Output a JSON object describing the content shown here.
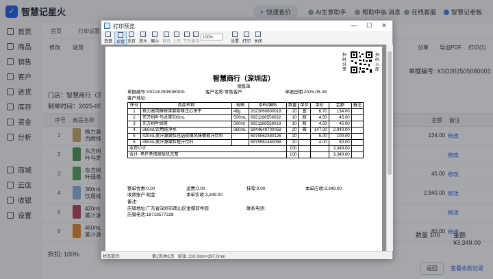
{
  "app": {
    "title": "智慧记星火",
    "quick_price": "快速查价",
    "ai_assistant": "AI生意助手",
    "help_center": "帮助中心",
    "messages": "消息",
    "online_customer": "在线客服",
    "account": "智慧记老板"
  },
  "sidebar": {
    "items": [
      {
        "label": "首页",
        "icon": "home-icon"
      },
      {
        "label": "商品",
        "icon": "goods-icon"
      },
      {
        "label": "销售",
        "icon": "sales-icon"
      },
      {
        "label": "客户",
        "icon": "customer-icon"
      },
      {
        "label": "进货",
        "icon": "purchase-icon"
      },
      {
        "label": "库存",
        "icon": "stock-icon"
      },
      {
        "label": "资金",
        "icon": "funds-icon"
      },
      {
        "label": "分析",
        "icon": "analysis-icon"
      },
      {
        "label": "商城",
        "icon": "mall-icon"
      },
      {
        "label": "云店",
        "icon": "cloud-store-icon"
      },
      {
        "label": "收银",
        "icon": "cashier-icon"
      },
      {
        "label": "设置",
        "icon": "settings-icon"
      }
    ]
  },
  "tabs": [
    "首页",
    "打印设置"
  ],
  "toolbar": {
    "modify": "修改",
    "return": "退货",
    "share": "分享",
    "export_pdf": "导出PDF",
    "print": "打印(1)"
  },
  "background": {
    "order_no": "单据编号: XSD202505080001",
    "store": "门店：智慧商行（深圳店）",
    "made_time": "制单时间：2025-05-08",
    "columns": [
      "序号",
      "商品名称",
      "金额",
      "备注"
    ],
    "rows": [
      {
        "no": "1",
        "name": "格力高百醇抹茶慕斯味注心饼干",
        "amount": "134.00",
        "action": "修改",
        "color": "#c9a86a"
      },
      {
        "no": "2",
        "name": "东方树叶乌龙茶500mL",
        "amount": "",
        "action": "修改",
        "color": "#4e9b5a"
      },
      {
        "no": "3",
        "name": "东方树叶绿茶",
        "amount": "45.00",
        "action": "修改",
        "color": "#5aa45f"
      },
      {
        "no": "4",
        "name": "360mL饮用纯净水",
        "amount": "2,940.00",
        "action": "修改",
        "color": "#8fb6dd"
      },
      {
        "no": "5",
        "name": "420mL美汁源爽粒花语玫瑰风味葡萄汁饮料",
        "amount": "",
        "action": "修改",
        "color": "#b8455f"
      },
      {
        "no": "6",
        "name": "450mL美汁源果粒橙汁饮料",
        "amount": "80.00",
        "action": "修改",
        "color": "#e58a2e"
      }
    ],
    "discount": "折扣: 100%",
    "sum_qty": "数量 100",
    "sum_amount": "金额 ¥3,349.00",
    "back_button": "返回",
    "record_link": "查看收款记录"
  },
  "print_window": {
    "title": "打印预览",
    "min_label": "—",
    "max_label": "☐",
    "close_label": "✕",
    "ribbon": [
      "选基",
      "正常",
      "适页",
      "放大",
      "缩小",
      "首页",
      "上页",
      "下页",
      "尾页",
      "设置",
      "打印",
      "关闭"
    ],
    "zoom": "100%",
    "status_hint": "状态提示:",
    "status_page": "第1页/共1页",
    "status_paper": "纸张: 210.0mm×297.0mm"
  },
  "receipt": {
    "title": "智慧商行（深圳店）",
    "subtitle": "销售单",
    "scan_left": "扫码分享",
    "scan_right": "扫码入库",
    "order_no": "单据编号:XSD202505080001",
    "customer_name": "客户名称:零售客户",
    "order_date": "单据日期:2025-05-08",
    "customer_address": "客户地址:",
    "columns": [
      "序号",
      "商品名称",
      "规格",
      "条码/编码",
      "数量",
      "单位",
      "单价",
      "金额",
      "备注"
    ],
    "items": [
      {
        "no": "1",
        "name": "格力高百醇抹茶慕斯味注心饼干",
        "spec": "48g",
        "code": "2023060600018",
        "qty": "20",
        "unit": "盒",
        "price": "6.70",
        "amount": "134.00",
        "note": ""
      },
      {
        "no": "2",
        "name": "东方树叶乌龙茶500mL",
        "spec": "500mL",
        "code": "6921168558032",
        "qty": "10",
        "unit": "瓶",
        "price": "4.50",
        "amount": "45.00",
        "note": ""
      },
      {
        "no": "3",
        "name": "东方树叶绿茶",
        "spec": "500ml",
        "code": "6921168558018",
        "qty": "10",
        "unit": "瓶",
        "price": "4.50",
        "amount": "45.00",
        "note": ""
      },
      {
        "no": "4",
        "name": "360mL饮用纯净水",
        "spec": "360mL",
        "code": "6944649700058",
        "qty": "20",
        "unit": "箱",
        "price": "147.00",
        "amount": "2,940.00",
        "note": ""
      },
      {
        "no": "5",
        "name": "420mL美汁源爽粒花语玫瑰风味葡萄汁饮料",
        "spec": "",
        "code": "6975562480126",
        "qty": "20",
        "unit": "",
        "price": "5.00",
        "amount": "100.00",
        "note": ""
      },
      {
        "no": "6",
        "name": "450mL美汁源果粒橙汁饮料",
        "spec": "",
        "code": "6975562480058",
        "qty": "20",
        "unit": "",
        "price": "4.00",
        "amount": "80.00",
        "note": ""
      }
    ],
    "page_subtotal_label": "本页小计",
    "page_subtotal_qty": "100",
    "page_subtotal_amount": "3,349.00",
    "total_label": "合计: 叁仟叁佰肆拾玖元整",
    "total_qty": "100",
    "total_amount": "3,349.00",
    "whole_discount": "整单优惠:0.00",
    "freight": "运费:0.00",
    "wipe": "抹零:0.00",
    "receivable": "本单应收:3,349.00",
    "account": "收款账户:现金",
    "received": "本单实收:3,349.00",
    "remark": "备注:",
    "store_address": "店铺地址:广东省深圳市南山区金蝶软件园",
    "contact_phone": "联系电话:",
    "store_phone": "店铺电话:18718577328"
  }
}
